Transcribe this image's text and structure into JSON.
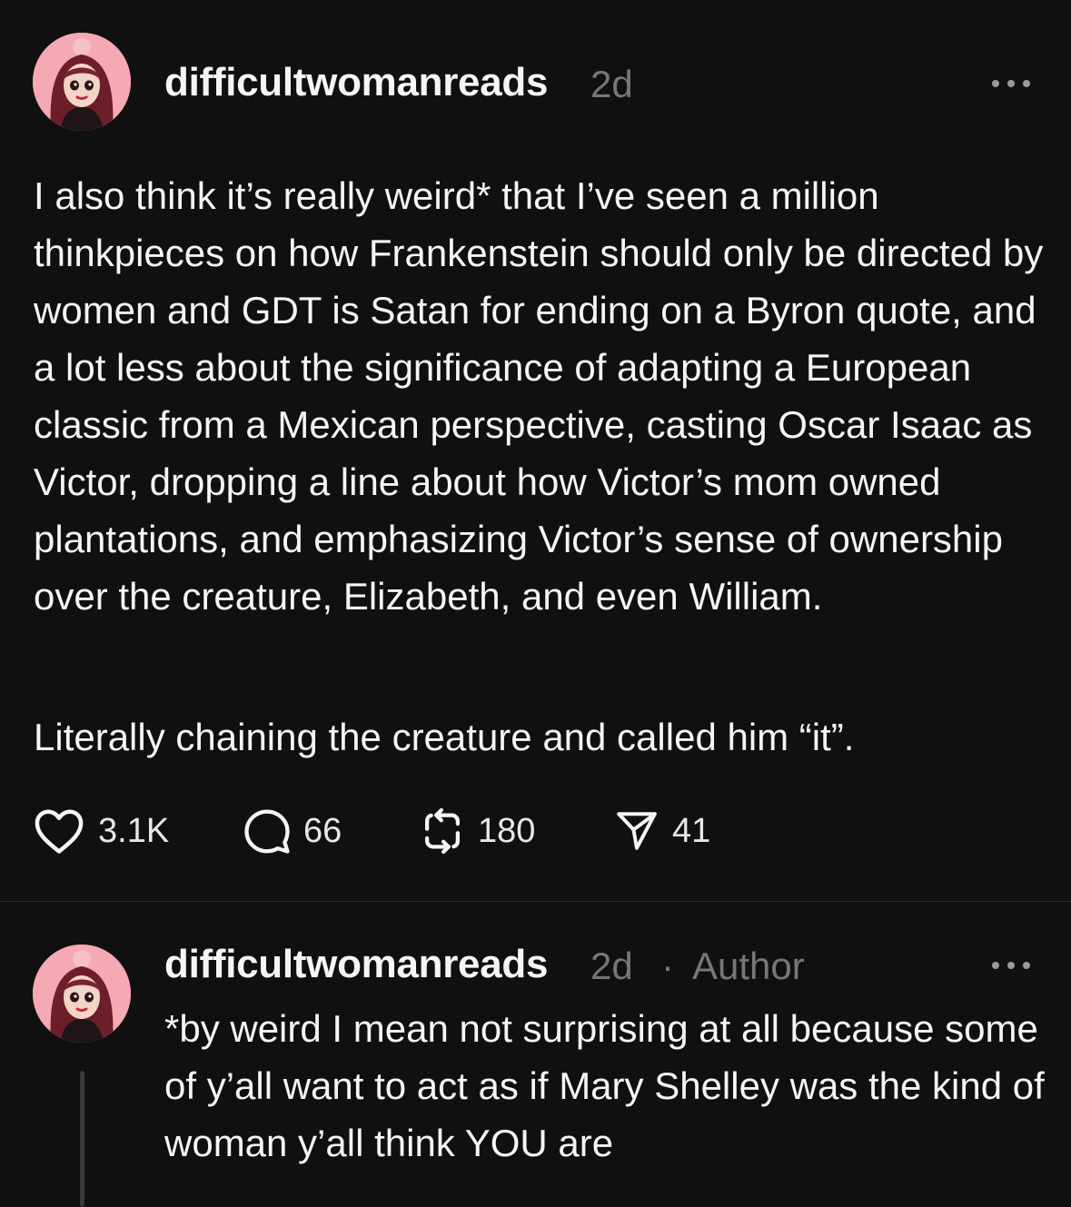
{
  "post": {
    "username": "difficultwomanreads",
    "time": "2d",
    "paragraphs": [
      "I also think it’s really weird* that I’ve seen a million thinkpieces on how Frankenstein should only be directed by women and GDT is Satan for ending on a Byron quote, and a lot less about the significance of adapting a European classic from a Mexican perspective, casting Oscar Isaac as Victor, dropping a line about how Victor’s mom owned plantations, and emphasizing Victor’s sense of ownership over the creature, Elizabeth, and even William.",
      "Literally chaining the creature and called him “it”."
    ],
    "actions": {
      "likes": "3.1K",
      "comments": "66",
      "reposts": "180",
      "shares": "41"
    }
  },
  "reply": {
    "username": "difficultwomanreads",
    "time": "2d",
    "separator": "·",
    "badge": "Author",
    "text": "*by weird I mean not surprising at all because some of y’all want to act as if Mary Shelley was the kind of woman y’all think YOU are"
  },
  "icons": {
    "like": "heart-icon",
    "comment": "comment-bubble-icon",
    "repost": "repost-icon",
    "share": "send-icon",
    "more": "more-dots-icon"
  },
  "colors": {
    "background": "#101010",
    "text": "#f3f5f7",
    "muted": "#777777",
    "avatar_bg": "#f4a9b4"
  }
}
